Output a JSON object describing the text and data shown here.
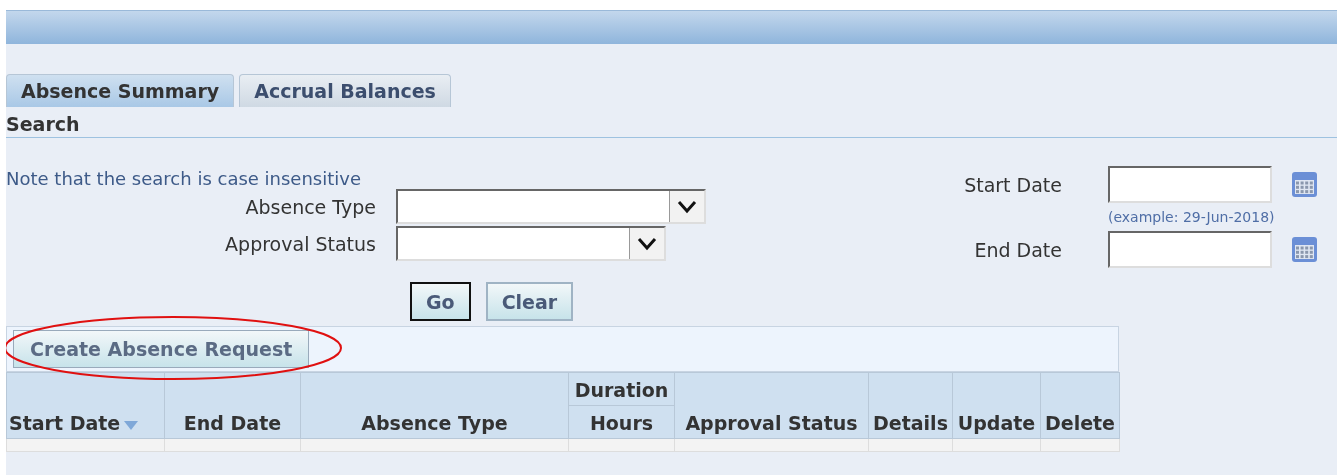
{
  "tabs": [
    {
      "label": "Absence Summary",
      "selected": true
    },
    {
      "label": "Accrual Balances",
      "selected": false
    }
  ],
  "section_title": "Search",
  "note": "Note that the search is case insensitive",
  "left_fields": [
    {
      "label": "Absence Type",
      "kind": "wide"
    },
    {
      "label": "Approval Status",
      "kind": "narrow"
    }
  ],
  "start_date": {
    "label": "Start Date",
    "hint": "(example: 29-Jun-2018)"
  },
  "end_date": {
    "label": "End Date"
  },
  "buttons": [
    {
      "label": "Go",
      "focused": true
    },
    {
      "label": "Clear",
      "focused": false
    }
  ],
  "create_button": "Create Absence Request",
  "table": {
    "group_header": "Duration",
    "columns": [
      {
        "label": "Start Date",
        "sorted": true,
        "grouped": false
      },
      {
        "label": "End Date",
        "sorted": false,
        "grouped": false
      },
      {
        "label": "Absence Type",
        "sorted": false,
        "grouped": false
      },
      {
        "label": "Hours",
        "sorted": false,
        "grouped": true
      },
      {
        "label": "Approval Status",
        "sorted": false,
        "grouped": false
      },
      {
        "label": "Details",
        "sorted": false,
        "grouped": false
      },
      {
        "label": "Update",
        "sorted": false,
        "grouped": false
      },
      {
        "label": "Delete",
        "sorted": false,
        "grouped": false
      }
    ]
  }
}
